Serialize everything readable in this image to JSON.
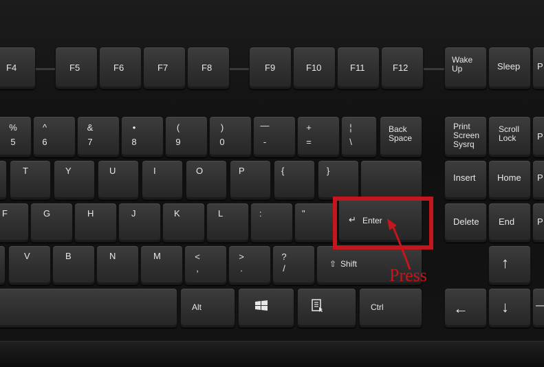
{
  "image": {
    "annotation": {
      "press_label": "Press",
      "highlight_color": "#c4161c"
    }
  },
  "keys": {
    "f4": "F4",
    "f5": "F5",
    "f6": "F6",
    "f7": "F7",
    "f8": "F8",
    "f9": "F9",
    "f10": "F10",
    "f11": "F11",
    "f12": "F12",
    "wake_up": "Wake\nUp",
    "sleep": "Sleep",
    "power_partial": "P",
    "num5_top": "%",
    "num5_bot": "5",
    "num6_top": "^",
    "num6_bot": "6",
    "num7_top": "&",
    "num7_bot": "7",
    "num8_top": "•",
    "num8_bot": "8",
    "num9_top": "(",
    "num9_bot": "9",
    "num0_top": ")",
    "num0_bot": "0",
    "minus_top": "—",
    "minus_bot": "-",
    "equals_top": "+",
    "equals_bot": "=",
    "backslash_top": "¦",
    "backslash_bot": "\\",
    "backspace": "Back\nSpace",
    "print_screen": "Print\nScreen\nSysrq",
    "scroll_lock": "Scroll\nLock",
    "pause_partial": "P",
    "t": "T",
    "y": "Y",
    "u": "U",
    "i": "I",
    "o": "O",
    "p": "P",
    "lbrace": "{",
    "rbrace": "}",
    "insert": "Insert",
    "home": "Home",
    "pgup_partial": "P",
    "f": "F",
    "g": "G",
    "h": "H",
    "j": "J",
    "k": "K",
    "l": "L",
    "colon": ":",
    "quote": "\"",
    "enter": "Enter",
    "delete": "Delete",
    "end": "End",
    "pgdn_partial": "P",
    "v": "V",
    "b": "B",
    "n": "N",
    "m": "M",
    "comma_top": "<",
    "comma_bot": ",",
    "period_top": ">",
    "period_bot": ".",
    "slash_top": "?",
    "slash_bot": "/",
    "shift": "Shift",
    "up": "↑",
    "alt": "Alt",
    "ctrl": "Ctrl",
    "left": "←",
    "down": "↓",
    "right_partial": "—"
  }
}
